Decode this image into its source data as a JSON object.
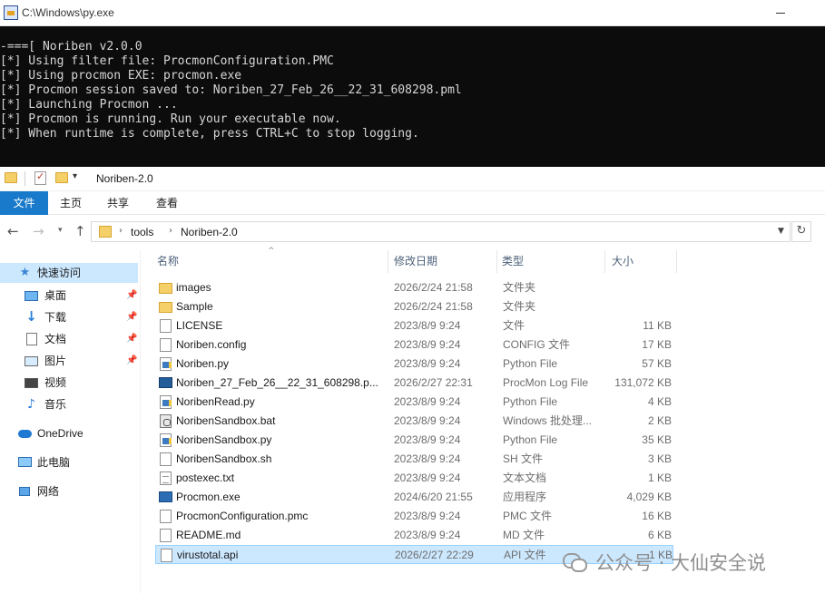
{
  "console": {
    "title": "C:\\Windows\\py.exe",
    "lines": [
      "-===[ Noriben v2.0.0",
      "[*] Using filter file: ProcmonConfiguration.PMC",
      "[*] Using procmon EXE: procmon.exe",
      "[*] Procmon session saved to: Noriben_27_Feb_26__22_31_608298.pml",
      "[*] Launching Procmon ...",
      "[*] Procmon is running. Run your executable now.",
      "[*] When runtime is complete, press CTRL+C to stop logging."
    ]
  },
  "explorer": {
    "title": "Noriben-2.0",
    "ribbon_tabs": [
      "文件",
      "主页",
      "共享",
      "查看"
    ],
    "breadcrumb": [
      "tools",
      "Noriben-2.0"
    ],
    "columns": {
      "name": "名称",
      "date": "修改日期",
      "type": "类型",
      "size": "大小"
    },
    "nav": {
      "quick_access": "快速访问",
      "quick_items": [
        "桌面",
        "下载",
        "文档",
        "图片",
        "视频",
        "音乐"
      ],
      "onedrive": "OneDrive",
      "this_pc": "此电脑",
      "network": "网络"
    },
    "files": [
      {
        "name": "images",
        "date": "2026/2/24 21:58",
        "type": "文件夹",
        "size": "",
        "icon": "folder-icon"
      },
      {
        "name": "Sample",
        "date": "2026/2/24 21:58",
        "type": "文件夹",
        "size": "",
        "icon": "folder-icon"
      },
      {
        "name": "LICENSE",
        "date": "2023/8/9 9:24",
        "type": "文件",
        "size": "11 KB",
        "icon": "file-icon"
      },
      {
        "name": "Noriben.config",
        "date": "2023/8/9 9:24",
        "type": "CONFIG 文件",
        "size": "17 KB",
        "icon": "file-icon"
      },
      {
        "name": "Noriben.py",
        "date": "2023/8/9 9:24",
        "type": "Python File",
        "size": "57 KB",
        "icon": "python-file-icon"
      },
      {
        "name": "Noriben_27_Feb_26__22_31_608298.p...",
        "date": "2026/2/27 22:31",
        "type": "ProcMon Log File",
        "size": "131,072 KB",
        "icon": "procmon-log-icon"
      },
      {
        "name": "NoribenRead.py",
        "date": "2023/8/9 9:24",
        "type": "Python File",
        "size": "4 KB",
        "icon": "python-file-icon"
      },
      {
        "name": "NoribenSandbox.bat",
        "date": "2023/8/9 9:24",
        "type": "Windows 批处理...",
        "size": "2 KB",
        "icon": "batch-file-icon"
      },
      {
        "name": "NoribenSandbox.py",
        "date": "2023/8/9 9:24",
        "type": "Python File",
        "size": "35 KB",
        "icon": "python-file-icon"
      },
      {
        "name": "NoribenSandbox.sh",
        "date": "2023/8/9 9:24",
        "type": "SH 文件",
        "size": "3 KB",
        "icon": "file-icon"
      },
      {
        "name": "postexec.txt",
        "date": "2023/8/9 9:24",
        "type": "文本文档",
        "size": "1 KB",
        "icon": "text-file-icon"
      },
      {
        "name": "Procmon.exe",
        "date": "2024/6/20 21:55",
        "type": "应用程序",
        "size": "4,029 KB",
        "icon": "exe-icon"
      },
      {
        "name": "ProcmonConfiguration.pmc",
        "date": "2023/8/9 9:24",
        "type": "PMC 文件",
        "size": "16 KB",
        "icon": "file-icon"
      },
      {
        "name": "README.md",
        "date": "2023/8/9 9:24",
        "type": "MD 文件",
        "size": "6 KB",
        "icon": "file-icon"
      },
      {
        "name": "virustotal.api",
        "date": "2026/2/27 22:29",
        "type": "API 文件",
        "size": "1 KB",
        "icon": "file-icon",
        "selected": true
      }
    ]
  },
  "watermark": "公众号 · 大仙安全说",
  "colors": {
    "console_bg": "#0c0c0c",
    "console_fg": "#d6d6d6",
    "file_tab": "#1979ca",
    "selection": "#cce8ff"
  }
}
